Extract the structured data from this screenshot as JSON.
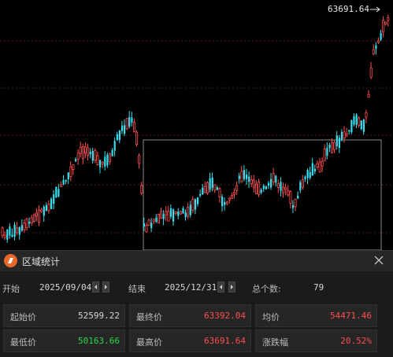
{
  "chart": {
    "peak_label": "63691.64",
    "colors": {
      "up": "#ff4d4d",
      "down": "#34e0f0",
      "selection": "#8a8a8a",
      "grid": "#5a1a1a"
    }
  },
  "panel": {
    "title": "区域统计",
    "start_label": "开始",
    "start_date": "2025/09/04",
    "end_label": "结束",
    "end_date": "2025/12/31",
    "count_label": "总个数:",
    "count_value": "79",
    "stats": [
      {
        "label": "起始价",
        "value": "52599.22",
        "tone": "neutral"
      },
      {
        "label": "最终价",
        "value": "63392.04",
        "tone": "up"
      },
      {
        "label": "均价",
        "value": "54471.46",
        "tone": "up"
      },
      {
        "label": "最低价",
        "value": "50163.66",
        "tone": "down"
      },
      {
        "label": "最高价",
        "value": "63691.64",
        "tone": "up"
      },
      {
        "label": "涨跌幅",
        "value": "20.52%",
        "tone": "up"
      }
    ],
    "icons": {
      "logo": "app-logo-icon",
      "close": "close-icon",
      "prev": "triangle-left-icon",
      "next": "triangle-right-icon"
    }
  }
}
